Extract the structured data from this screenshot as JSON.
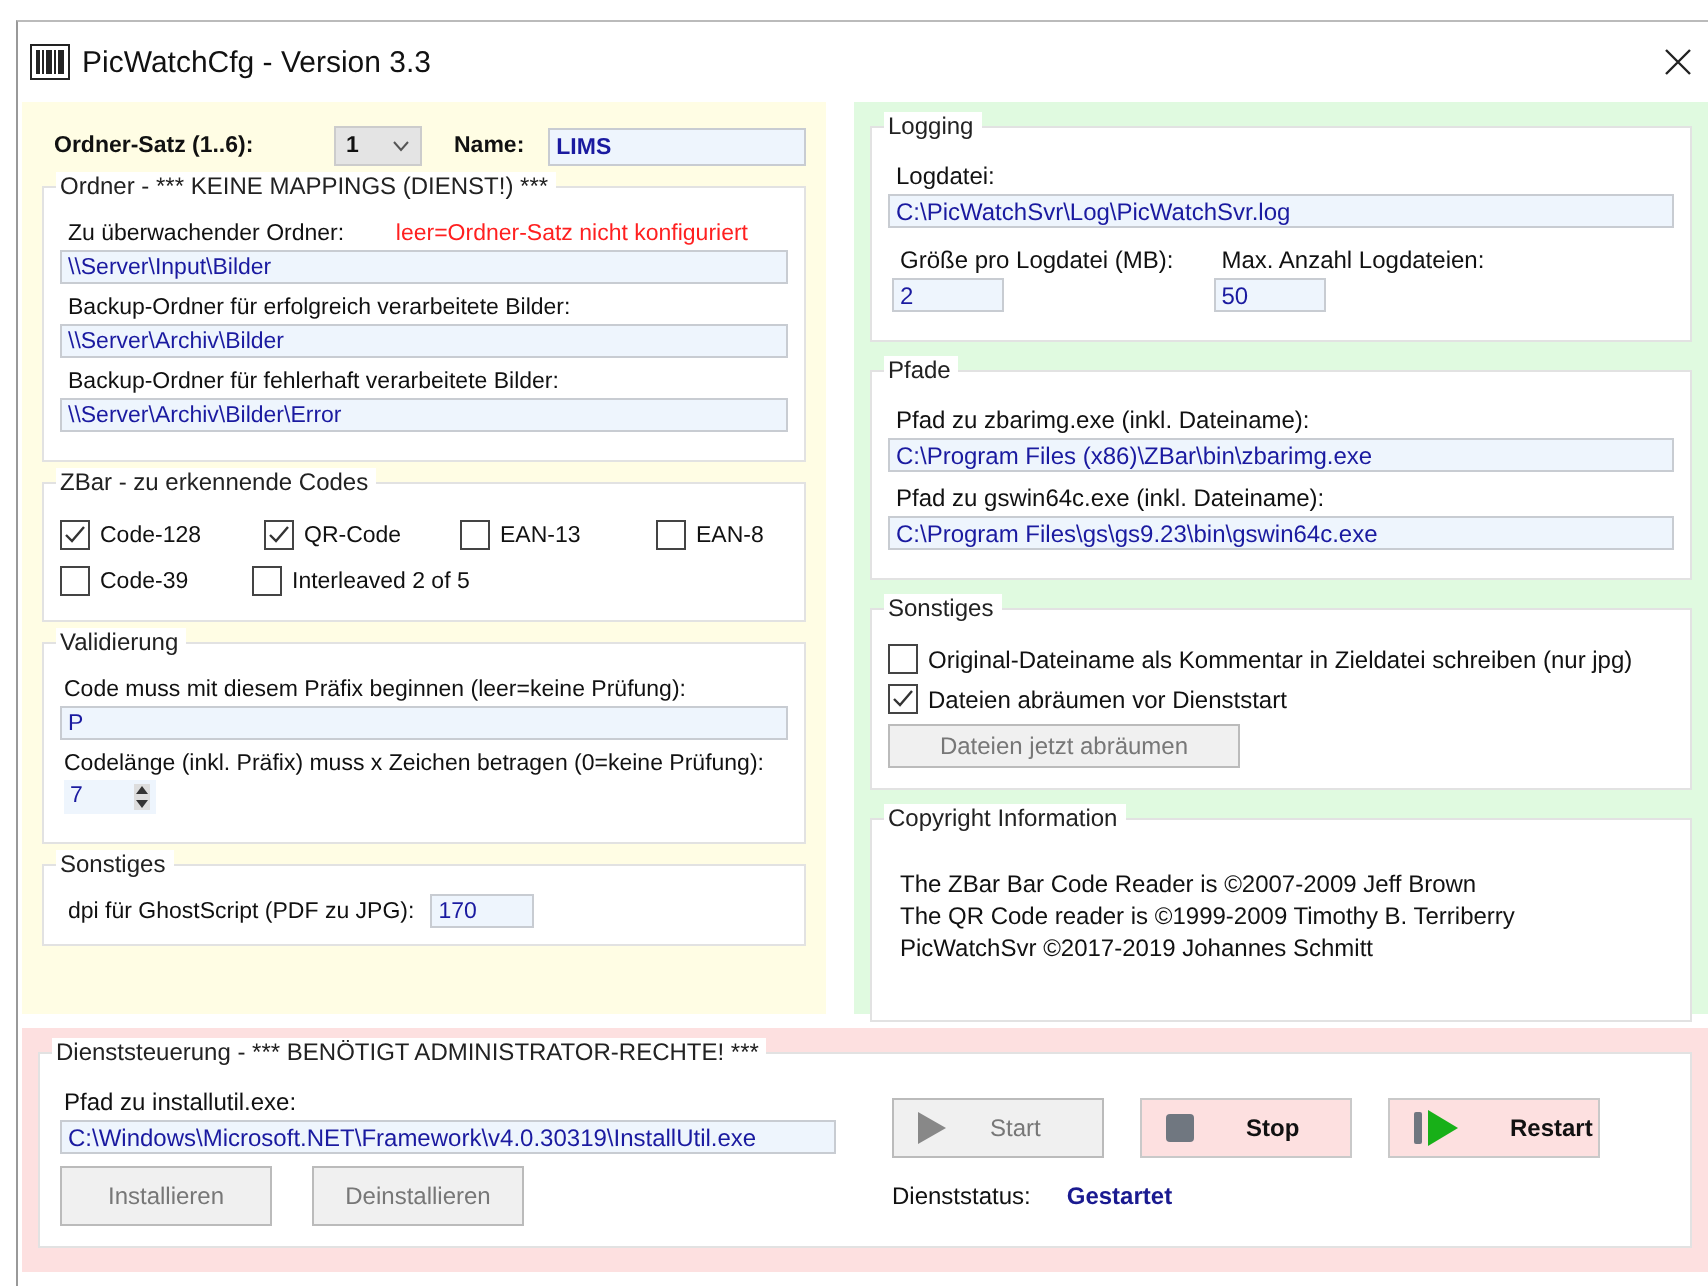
{
  "window": {
    "title": "PicWatchCfg - Version 3.3"
  },
  "header": {
    "set_label": "Ordner-Satz (1..6):",
    "set_value": "1",
    "name_label": "Name:",
    "name_value": "LIMS"
  },
  "folders": {
    "title": "Ordner  - *** KEINE MAPPINGS (DIENST!) ***",
    "fields": [
      {
        "label": "Zu überwachender Ordner:",
        "hint": "leer=Ordner-Satz nicht konfiguriert",
        "value": "\\\\Server\\Input\\Bilder"
      },
      {
        "label": "Backup-Ordner für erfolgreich verarbeitete Bilder:",
        "value": "\\\\Server\\Archiv\\Bilder"
      },
      {
        "label": "Backup-Ordner für fehlerhaft verarbeitete Bilder:",
        "value": "\\\\Server\\Archiv\\Bilder\\Error"
      }
    ]
  },
  "zbar": {
    "title": "ZBar - zu erkennende Codes",
    "rows": [
      [
        {
          "label": "Code-128",
          "checked": true
        },
        {
          "label": "QR-Code",
          "checked": true
        },
        {
          "label": "EAN-13",
          "checked": false
        },
        {
          "label": "EAN-8",
          "checked": false
        }
      ],
      [
        {
          "label": "Code-39",
          "checked": false
        },
        {
          "label": "Interleaved 2 of 5",
          "checked": false
        }
      ]
    ]
  },
  "validation": {
    "title": "Validierung",
    "prefix_label": "Code muss mit diesem Präfix beginnen (leer=keine Prüfung):",
    "prefix_value": "P",
    "length_label": "Codelänge (inkl. Präfix) muss x Zeichen betragen (0=keine Prüfung):",
    "length_value": "7"
  },
  "misc_left": {
    "title": "Sonstiges",
    "dpi_label": "dpi für GhostScript (PDF zu JPG):",
    "dpi_value": "170"
  },
  "logging": {
    "title": "Logging",
    "file_label": "Logdatei:",
    "file_value": "C:\\PicWatchSvr\\Log\\PicWatchSvr.log",
    "size_label": "Größe pro Logdatei (MB):",
    "size_value": "2",
    "count_label": "Max. Anzahl Logdateien:",
    "count_value": "50"
  },
  "paths": {
    "title": "Pfade",
    "fields": [
      {
        "label": "Pfad zu zbarimg.exe (inkl. Dateiname):",
        "value": "C:\\Program Files (x86)\\ZBar\\bin\\zbarimg.exe"
      },
      {
        "label": "Pfad zu gswin64c.exe (inkl. Dateiname):",
        "value": "C:\\Program Files\\gs\\gs9.23\\bin\\gswin64c.exe"
      }
    ]
  },
  "misc_right": {
    "title": "Sonstiges",
    "options": [
      {
        "label": "Original-Dateiname als Kommentar in Zieldatei schreiben (nur jpg)",
        "checked": false
      },
      {
        "label": "Dateien abräumen vor Dienststart",
        "checked": true
      }
    ],
    "button": {
      "label": "Dateien jetzt abräumen",
      "disabled": true
    }
  },
  "copyright": {
    "title": "Copyright Information",
    "lines": [
      "The ZBar Bar Code Reader is ©2007-2009 Jeff Brown",
      "The QR Code reader is ©1999-2009 Timothy B. Terriberry",
      "PicWatchSvr ©2017-2019 Johannes Schmitt"
    ]
  },
  "service": {
    "title": "Dienststeuerung - *** BENÖTIGT ADMINISTRATOR-RECHTE! ***",
    "path_label": "Pfad zu installutil.exe:",
    "path_value": "C:\\Windows\\Microsoft.NET\\Framework\\v4.0.30319\\InstallUtil.exe",
    "buttons": [
      {
        "label": "Installieren",
        "disabled": true
      },
      {
        "label": "Deinstallieren",
        "disabled": true
      }
    ],
    "controls": [
      {
        "kind": "start",
        "label": "Start",
        "disabled": true
      },
      {
        "kind": "stop",
        "label": "Stop",
        "disabled": false
      },
      {
        "kind": "restart",
        "label": "Restart",
        "disabled": false
      }
    ],
    "status_label": "Dienststatus:",
    "status_value": "Gestartet"
  }
}
